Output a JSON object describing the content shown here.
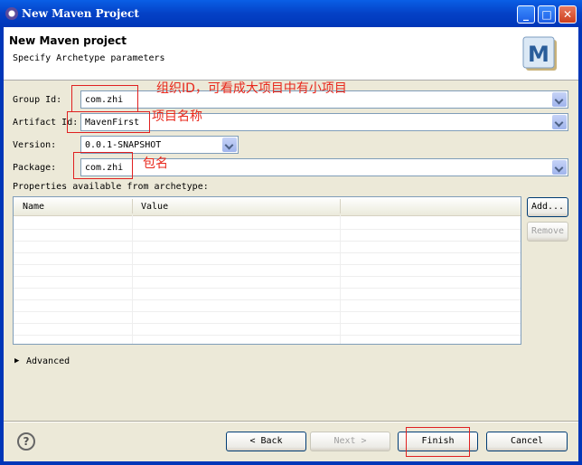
{
  "window": {
    "title": "New Maven Project"
  },
  "header": {
    "title": "New Maven project",
    "subtitle": "Specify Archetype parameters",
    "logo_letter": "M"
  },
  "form": {
    "group_id": {
      "label": "Group Id:",
      "value": "com.zhi"
    },
    "artifact_id": {
      "label": "Artifact Id:",
      "value": "MavenFirst"
    },
    "version": {
      "label": "Version:",
      "value": "0.0.1-SNAPSHOT"
    },
    "package": {
      "label": "Package:",
      "value": "com.zhi"
    },
    "properties_label": "Properties available from archetype:"
  },
  "annotations": {
    "group_id": "组织ID，可看成大项目中有小项目",
    "artifact_id": "项目名称",
    "package": "包名"
  },
  "table": {
    "columns": [
      "Name",
      "Value"
    ]
  },
  "side_buttons": {
    "add": "Add...",
    "remove": "Remove"
  },
  "advanced": {
    "label": "Advanced"
  },
  "footer": {
    "back": "< Back",
    "next": "Next >",
    "finish": "Finish",
    "cancel": "Cancel",
    "help": "?"
  },
  "colors": {
    "annotation": "#e8281c",
    "titlebar": "#0441c6"
  }
}
